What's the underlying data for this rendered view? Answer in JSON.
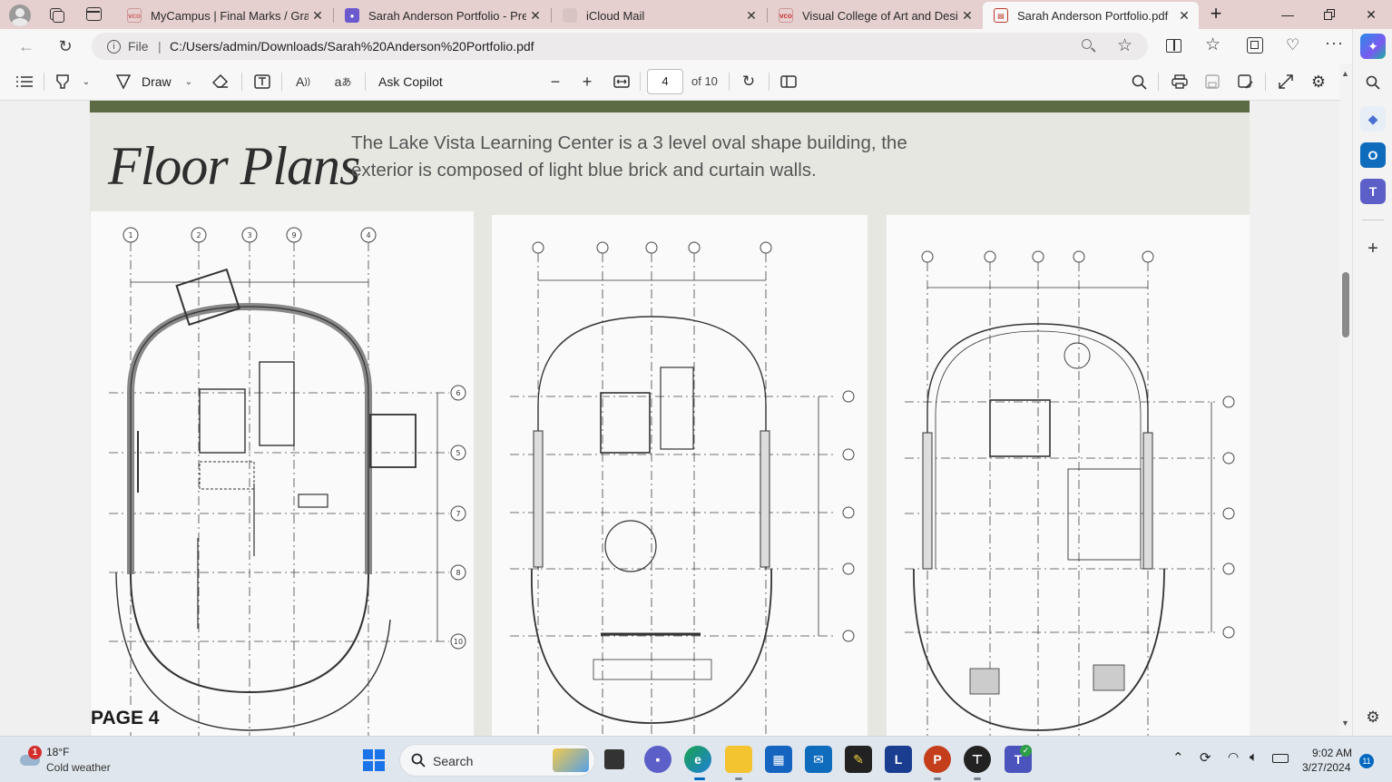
{
  "tabs": [
    {
      "title": "MyCampus | Final Marks / Grade",
      "favicon": "vco-icon"
    },
    {
      "title": "Sarah Anderson Portfolio - Prese",
      "favicon": "portfolio-icon"
    },
    {
      "title": "iCloud Mail",
      "favicon": "icloud-icon"
    },
    {
      "title": "Visual College of Art and Design",
      "favicon": "vco-icon"
    },
    {
      "title": "Sarah Anderson Portfolio.pdf",
      "favicon": "pdf-icon",
      "active": true
    }
  ],
  "address": {
    "scheme_label": "File",
    "url": "C:/Users/admin/Downloads/Sarah%20Anderson%20Portfolio.pdf"
  },
  "pdf_toolbar": {
    "draw_label": "Draw",
    "ask_copilot_label": "Ask Copilot",
    "page_number": "4",
    "page_total": "of 10"
  },
  "document": {
    "title": "Floor Plans",
    "description": "The Lake Vista Learning Center is a 3 level oval shape building, the exterior is composed of light blue brick and curtain walls.",
    "page_label": "PAGE 4",
    "plan_grid_labels": [
      "1",
      "2",
      "3",
      "9",
      "4",
      "6",
      "5",
      "7",
      "8",
      "10"
    ]
  },
  "taskbar": {
    "weather_temp": "18°F",
    "weather_desc": "Cold weather",
    "weather_badge": "1",
    "search_placeholder": "Search",
    "time": "9:02 AM",
    "date": "3/27/2024",
    "notification_count": "11"
  },
  "colors": {
    "tab_strip": "#e6cfcf",
    "page_band": "#5c6b43",
    "accent": "#0067c0"
  }
}
